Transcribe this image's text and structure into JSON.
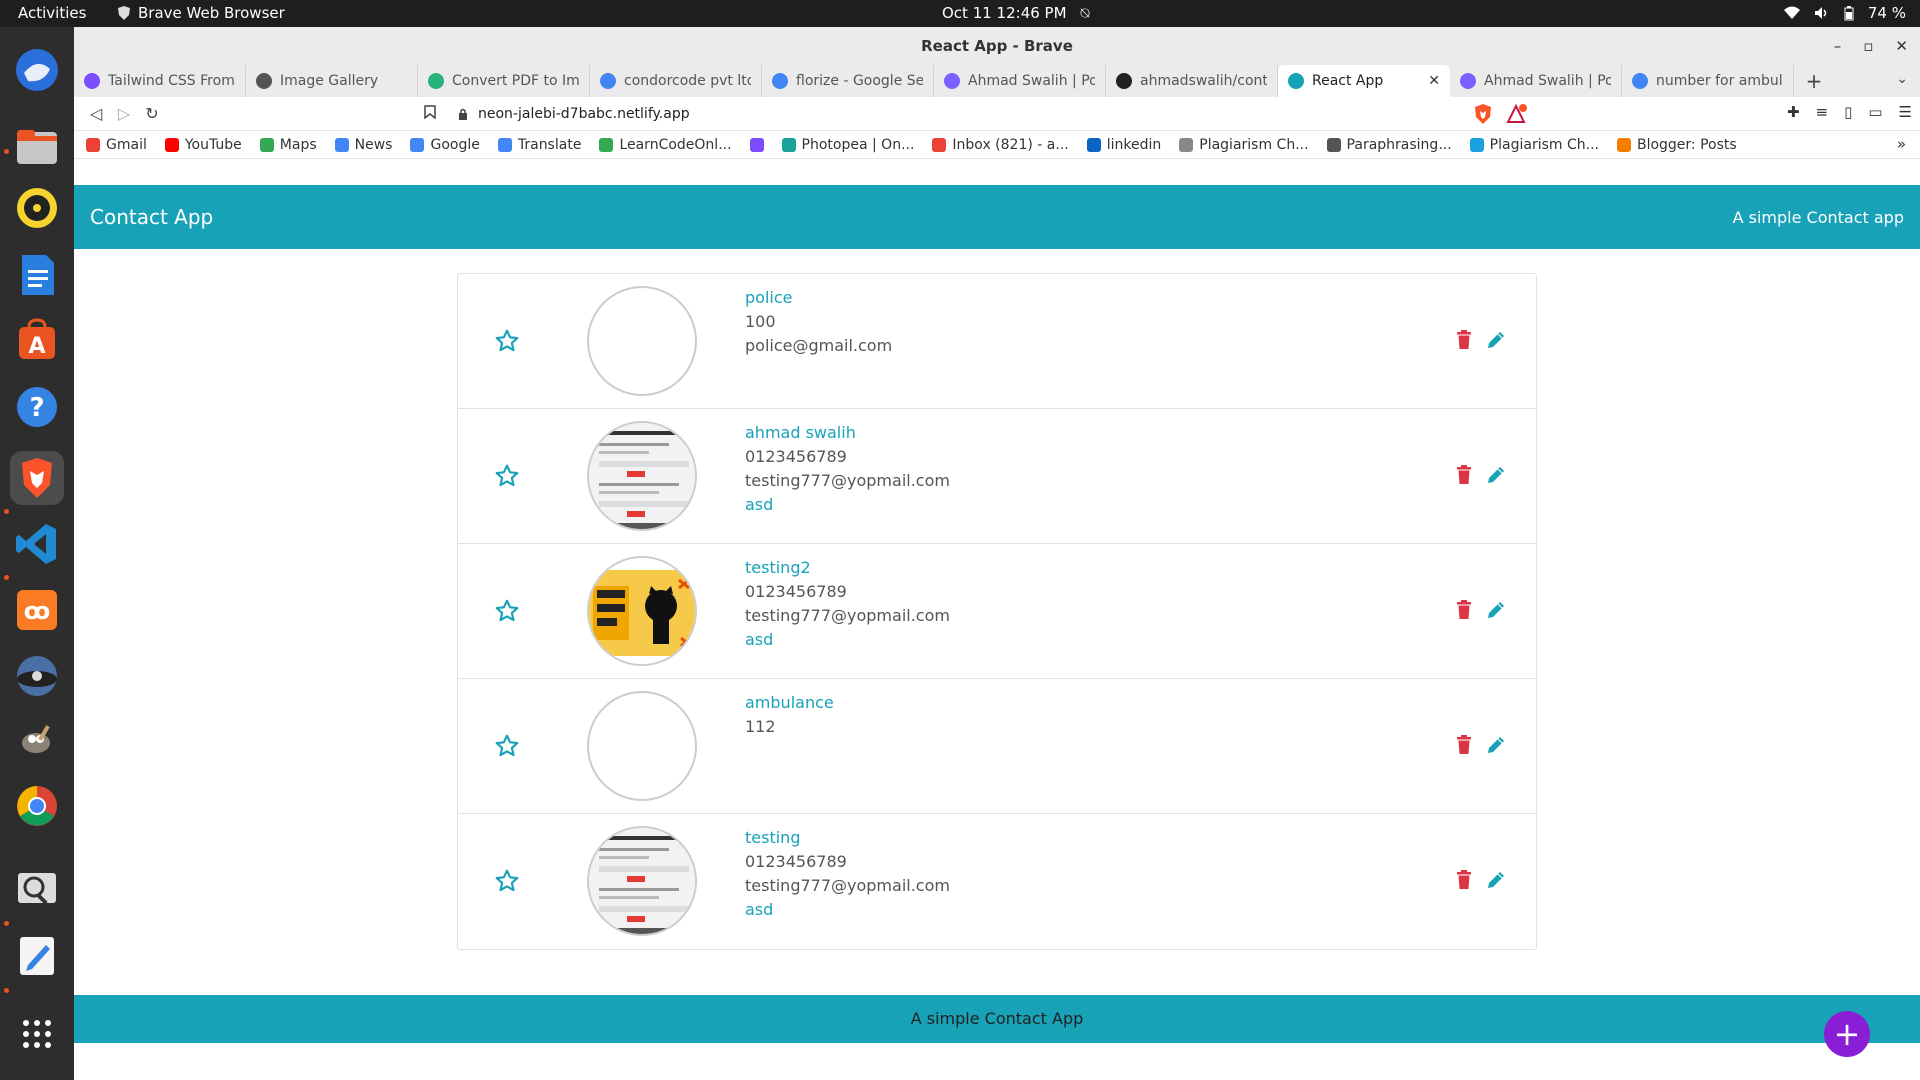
{
  "topbar": {
    "activities": "Activities",
    "app_name": "Brave Web Browser",
    "date_time": "Oct 11  12:46 PM",
    "battery": "74 %"
  },
  "window": {
    "title": "React App - Brave"
  },
  "tabs": [
    {
      "label": "Tailwind CSS From S",
      "icon": "tailwind-icon",
      "color": "#7c4dff"
    },
    {
      "label": "Image Gallery",
      "icon": "globe-icon",
      "color": "#555555"
    },
    {
      "label": "Convert PDF to Imag",
      "icon": "convert-icon",
      "color": "#2ab27b"
    },
    {
      "label": "condorcode pvt ltd.",
      "icon": "google-icon",
      "color": "#4285f4"
    },
    {
      "label": "florize - Google Sear",
      "icon": "google-icon",
      "color": "#4285f4"
    },
    {
      "label": "Ahmad Swalih | Port",
      "icon": "portfolio-icon",
      "color": "#7b61ff"
    },
    {
      "label": "ahmadswalih/conta",
      "icon": "github-icon",
      "color": "#222222"
    },
    {
      "label": "React App",
      "icon": "react-icon",
      "color": "#17a2b8",
      "active": true
    },
    {
      "label": "Ahmad Swalih | Port",
      "icon": "portfolio-icon",
      "color": "#7b61ff"
    },
    {
      "label": "number for ambula",
      "icon": "google-icon",
      "color": "#4285f4"
    }
  ],
  "url": "neon-jalebi-d7babc.netlify.app",
  "bookmarks": [
    {
      "label": "Gmail",
      "icon": "gmail-icon",
      "color": "#ea4335"
    },
    {
      "label": "YouTube",
      "icon": "youtube-icon",
      "color": "#ff0000"
    },
    {
      "label": "Maps",
      "icon": "maps-icon",
      "color": "#34a853"
    },
    {
      "label": "News",
      "icon": "news-icon",
      "color": "#4285f4"
    },
    {
      "label": "Google",
      "icon": "google-icon",
      "color": "#4285f4"
    },
    {
      "label": "Translate",
      "icon": "translate-icon",
      "color": "#4285f4"
    },
    {
      "label": "LearnCodeOnl...",
      "icon": "play-icon",
      "color": "#34a853"
    },
    {
      "label": "",
      "icon": "tailwind-icon",
      "color": "#7c4dff"
    },
    {
      "label": "Photopea | On...",
      "icon": "photopea-icon",
      "color": "#18a497"
    },
    {
      "label": "Inbox (821) - a...",
      "icon": "gmail-icon",
      "color": "#ea4335"
    },
    {
      "label": "linkedin",
      "icon": "linkedin-icon",
      "color": "#0a66c2"
    },
    {
      "label": "Plagiarism Ch...",
      "icon": "sst-icon",
      "color": "#888888"
    },
    {
      "label": "Paraphrasing...",
      "icon": "quill-icon",
      "color": "#555555"
    },
    {
      "label": "Plagiarism Ch...",
      "icon": "plagiarism-icon",
      "color": "#1ba1e2"
    },
    {
      "label": "Blogger: Posts",
      "icon": "blogger-icon",
      "color": "#f57d00"
    }
  ],
  "app": {
    "brand": "Contact App",
    "tagline": "A simple Contact app",
    "footer": "A simple Contact App",
    "fab": "+"
  },
  "contacts": [
    {
      "name": "police",
      "phone": "100",
      "email": "police@gmail.com",
      "note": "",
      "avatar": "empty"
    },
    {
      "name": "ahmad swalih",
      "phone": "0123456789",
      "email": "testing777@yopmail.com",
      "note": "asd",
      "avatar": "screenshot"
    },
    {
      "name": "testing2",
      "phone": "0123456789",
      "email": "testing777@yopmail.com",
      "note": "asd",
      "avatar": "github-firebase"
    },
    {
      "name": "ambulance",
      "phone": "112",
      "email": "",
      "note": "",
      "avatar": "empty"
    },
    {
      "name": "testing",
      "phone": "0123456789",
      "email": "testing777@yopmail.com",
      "note": "asd",
      "avatar": "screenshot"
    }
  ],
  "colors": {
    "accent": "#17a2b8",
    "delete": "#dc3545",
    "fab": "#8a1ed6"
  }
}
